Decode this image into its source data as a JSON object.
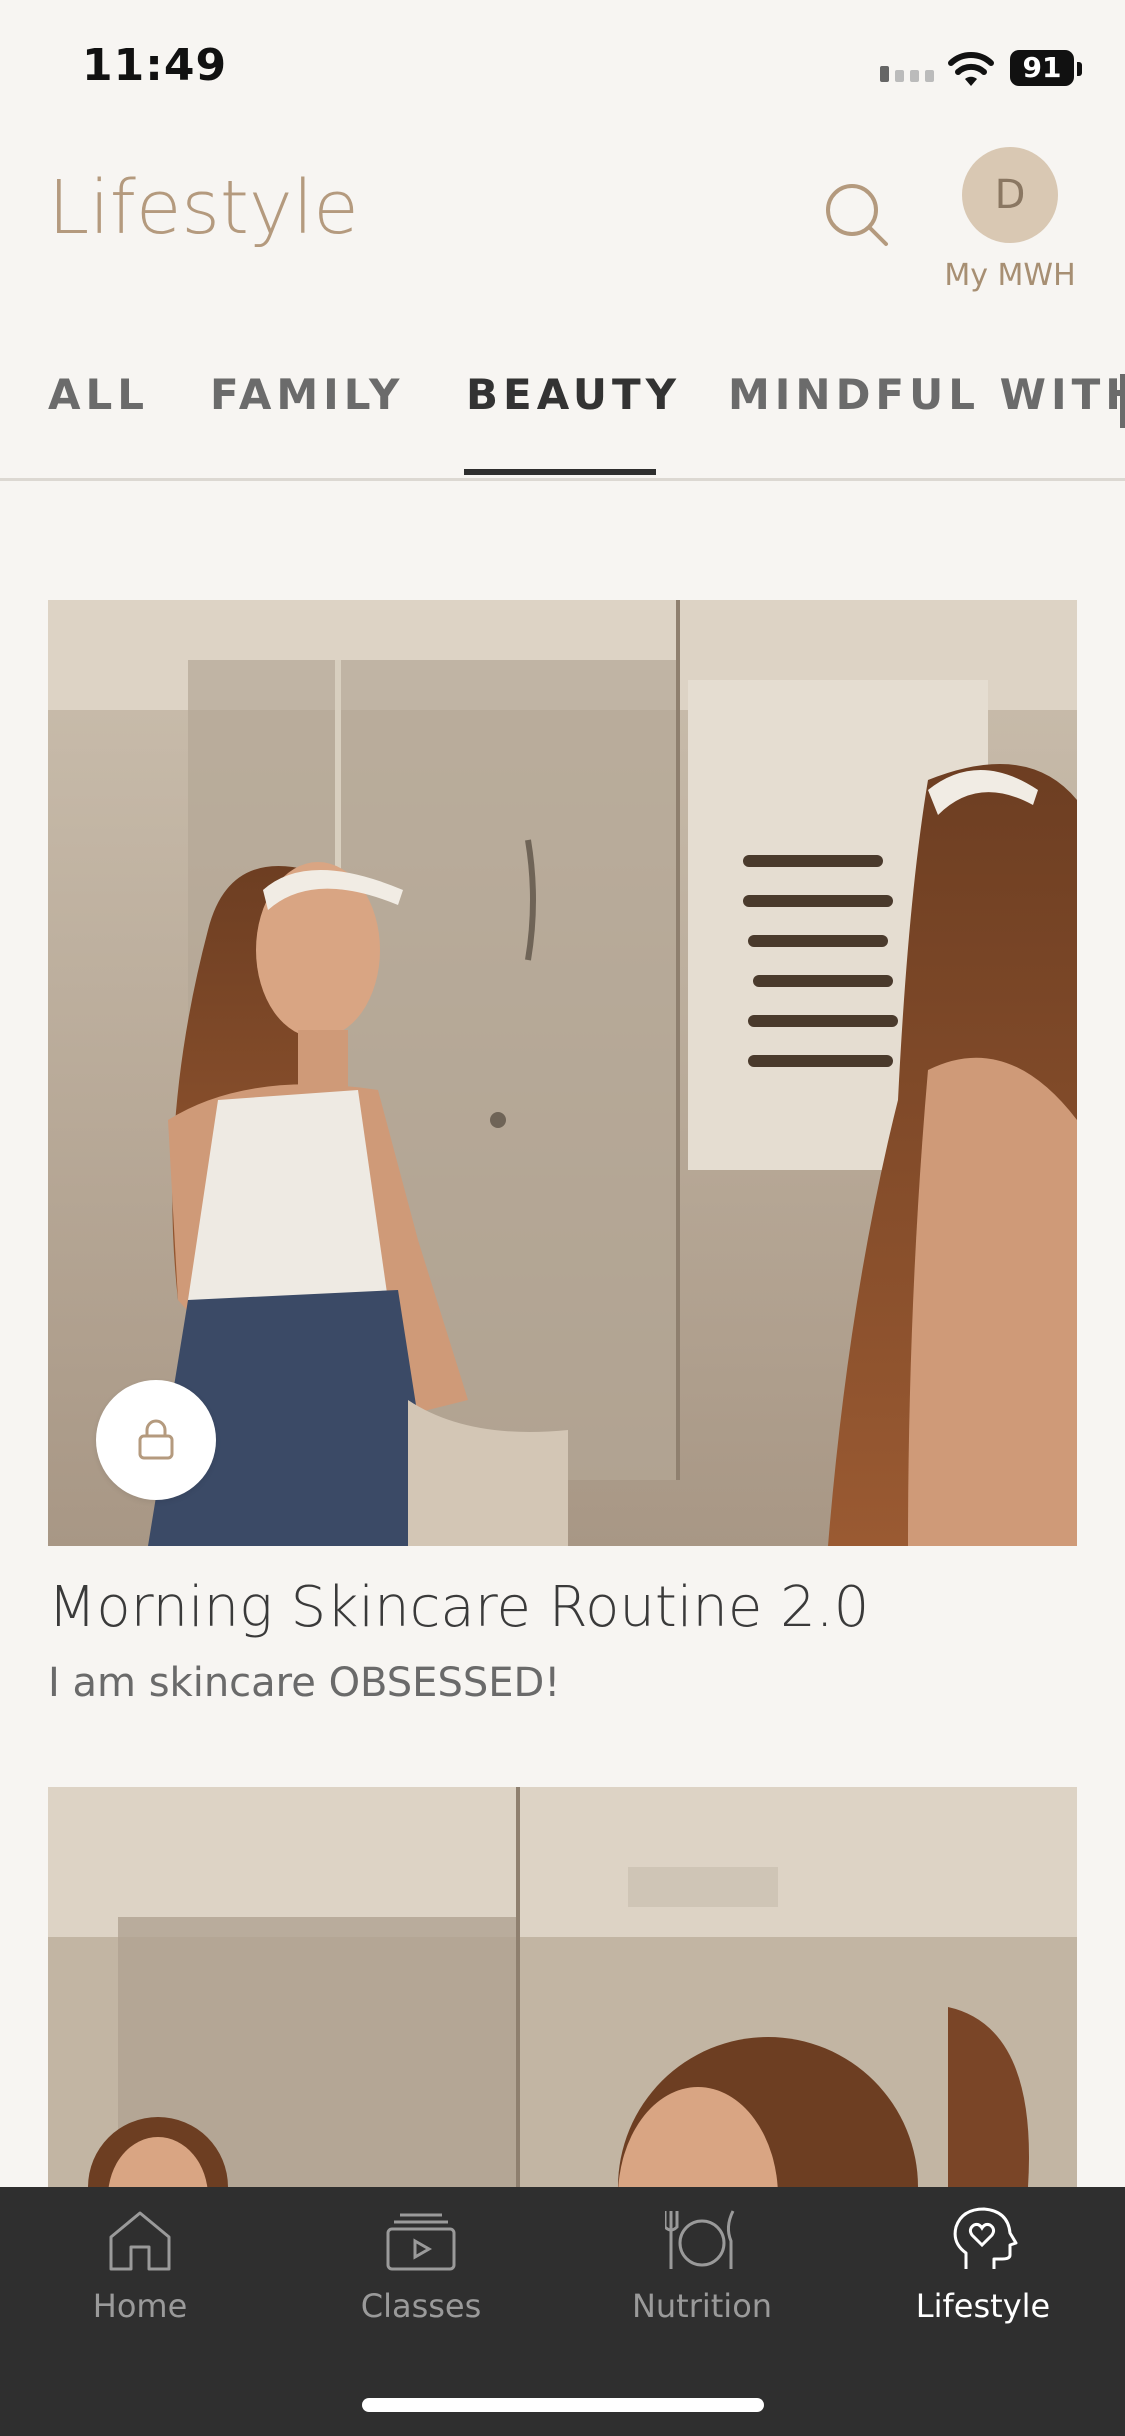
{
  "status_bar": {
    "time": "11:49",
    "battery": "91"
  },
  "header": {
    "title": "Lifestyle",
    "avatar_initial": "D",
    "avatar_label": "My MWH"
  },
  "tabs": [
    {
      "label": "ALL"
    },
    {
      "label": "FAMILY"
    },
    {
      "label": "BEAUTY",
      "active": true
    },
    {
      "label": "MINDFUL WITH"
    }
  ],
  "cards": [
    {
      "title": "Morning Skincare Routine 2.0",
      "subtitle": "I am skincare OBSESSED!",
      "locked": true
    },
    {
      "title": "",
      "subtitle": ""
    }
  ],
  "bottom_nav": [
    {
      "label": "Home",
      "icon": "home-icon"
    },
    {
      "label": "Classes",
      "icon": "classes-icon"
    },
    {
      "label": "Nutrition",
      "icon": "nutrition-icon"
    },
    {
      "label": "Lifestyle",
      "icon": "lifestyle-icon",
      "active": true
    }
  ],
  "colors": {
    "accent": "#b49a7e",
    "background": "#f7f5f2",
    "nav_bg": "#2f2f2f"
  }
}
